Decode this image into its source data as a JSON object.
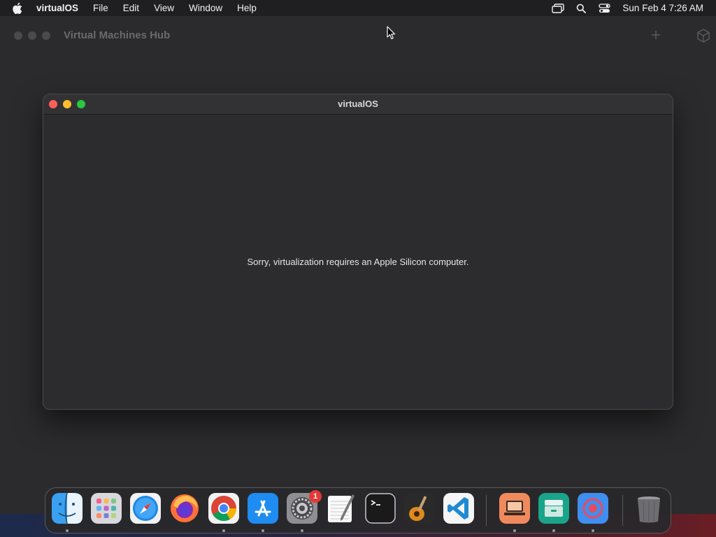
{
  "menubar": {
    "app_name": "virtualOS",
    "menus": [
      "File",
      "Edit",
      "View",
      "Window",
      "Help"
    ],
    "clock": "Sun Feb 4  7:26 AM",
    "status_icons": [
      "screen-mirroring-icon",
      "search-icon",
      "control-center-icon"
    ]
  },
  "hub_window": {
    "title": "Virtual Machines Hub",
    "toolbar_icons": [
      "plus-icon",
      "cube-icon"
    ]
  },
  "vm_window": {
    "title": "virtualOS",
    "message": "Sorry, virtualization requires an Apple Silicon computer."
  },
  "dock": {
    "apps": [
      {
        "name": "finder",
        "running": true
      },
      {
        "name": "launchpad",
        "running": false
      },
      {
        "name": "safari",
        "running": false
      },
      {
        "name": "firefox",
        "running": false
      },
      {
        "name": "chrome",
        "running": true
      },
      {
        "name": "app-store",
        "running": true
      },
      {
        "name": "system-settings",
        "running": true,
        "badge": "1"
      },
      {
        "name": "textedit",
        "running": false
      },
      {
        "name": "terminal",
        "running": false
      },
      {
        "name": "garageband",
        "running": false
      },
      {
        "name": "vscode",
        "running": false
      }
    ],
    "recent_apps": [
      {
        "name": "virtualos-app",
        "running": true
      },
      {
        "name": "archive-utility",
        "running": true
      },
      {
        "name": "screen-recorder",
        "running": true
      }
    ],
    "trash": {
      "name": "trash"
    }
  },
  "colors": {
    "close": "#ff5f57",
    "minimize": "#febc2e",
    "maximize": "#28c840",
    "badge": "#e53935"
  }
}
